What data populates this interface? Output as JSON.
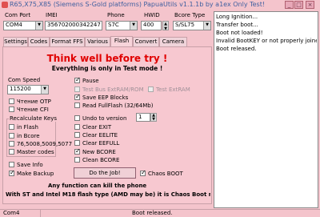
{
  "window": {
    "title": "R65,X75,X85 (Siemens S-Gold platforms) PapuaUtils v1.1.1b by a1ex Only Test!"
  },
  "header": {
    "com_port_label": "Com Port",
    "com_port_value": "COM4",
    "imei_label": "IMEI",
    "imei_value": "356702000342247",
    "phone_label": "Phone",
    "phone_value": "S7C",
    "hwid_label": "HWID",
    "hwid_value": "400",
    "bcore_label": "Bcore Type",
    "bcore_value": "S/SL75"
  },
  "tabs": [
    "Settings",
    "Codes",
    "Format FFS",
    "Various",
    "Flash",
    "Convert",
    "Camera"
  ],
  "active_tab": "Flash",
  "flash": {
    "headline": "Think well before try !",
    "subline": "Everything is only in Test mode !",
    "com_speed_label": "Com Speed",
    "com_speed_value": "115200",
    "read_otp": "Чтение OTP",
    "read_cfi": "Чтение CFI",
    "recalc_group": "Recalculate Keys",
    "in_flash": "in Flash",
    "in_bcore": "in Bcore",
    "keys_values": "76,5008,5009,5077",
    "master_codes": "Master codes",
    "save_info": "Save Info",
    "make_backup": "Make Backup",
    "pause": "Pause",
    "test_bus": "Test Bus ExtRAM/ROM",
    "test_extram": "Test ExtRAM",
    "save_eep": "Save EEP Blocks",
    "read_fullflash": "Read FullFlash (32/64Mb)",
    "undo_version": "Undo to version",
    "undo_value": "1",
    "clear_exit": "Clear EXIT",
    "clear_eelite": "Clear EELITE",
    "clear_eefull": "Clear EEFULL",
    "new_bcore": "New BCORE",
    "clean_bcore": "Clean BCORE",
    "do_job": "Do the Job!",
    "chaos_boot": "Chaos BOOT",
    "warning1": "Any function can kill the phone",
    "warning2": "With ST and Intel M18 flash type (AMD may be) it is Chaos Boot requ"
  },
  "log": {
    "lines": [
      "Long Ignition...",
      "Transfer boot...",
      "Boot not loaded!",
      "Invalid BootKEY or not properly joine",
      "Boot released."
    ]
  },
  "status": {
    "port": "Com4",
    "message": "Boot released."
  },
  "colors": {
    "background": "#f4c4cc",
    "headline": "#e00000",
    "title": "#4060a0"
  }
}
